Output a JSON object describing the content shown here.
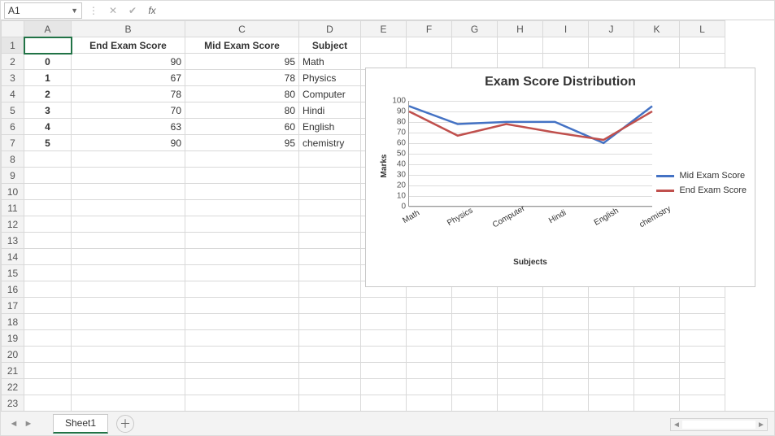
{
  "formula_bar": {
    "name_box": "A1",
    "fx_label": "fx",
    "formula": ""
  },
  "columns": [
    "A",
    "B",
    "C",
    "D",
    "E",
    "F",
    "G",
    "H",
    "I",
    "J",
    "K",
    "L"
  ],
  "row_numbers": [
    1,
    2,
    3,
    4,
    5,
    6,
    7,
    8,
    9,
    10,
    11,
    12,
    13,
    14,
    15,
    16,
    17,
    18,
    19,
    20,
    21,
    22,
    23
  ],
  "sheet": {
    "header": {
      "A": "",
      "B": "End Exam Score",
      "C": "Mid Exam Score",
      "D": "Subject"
    },
    "rows": [
      {
        "idx": "0",
        "end": 90,
        "mid": 95,
        "sub": "Math"
      },
      {
        "idx": "1",
        "end": 67,
        "mid": 78,
        "sub": "Physics"
      },
      {
        "idx": "2",
        "end": 78,
        "mid": 80,
        "sub": "Computer"
      },
      {
        "idx": "3",
        "end": 70,
        "mid": 80,
        "sub": "Hindi"
      },
      {
        "idx": "4",
        "end": 63,
        "mid": 60,
        "sub": "English"
      },
      {
        "idx": "5",
        "end": 90,
        "mid": 95,
        "sub": "chemistry"
      }
    ]
  },
  "tabs": {
    "active": "Sheet1"
  },
  "chart_data": {
    "type": "line",
    "title": "Exam Score Distribution",
    "xlabel": "Subjects",
    "ylabel": "Marks",
    "ylim": [
      0,
      100
    ],
    "yticks": [
      0,
      10,
      20,
      30,
      40,
      50,
      60,
      70,
      80,
      90,
      100
    ],
    "categories": [
      "Math",
      "Physics",
      "Computer",
      "Hindi",
      "English",
      "chemistry"
    ],
    "series": [
      {
        "name": "Mid Exam Score",
        "color": "#4472c4",
        "values": [
          95,
          78,
          80,
          80,
          60,
          95
        ]
      },
      {
        "name": "End Exam Score",
        "color": "#c0504d",
        "values": [
          90,
          67,
          78,
          70,
          63,
          90
        ]
      }
    ]
  }
}
